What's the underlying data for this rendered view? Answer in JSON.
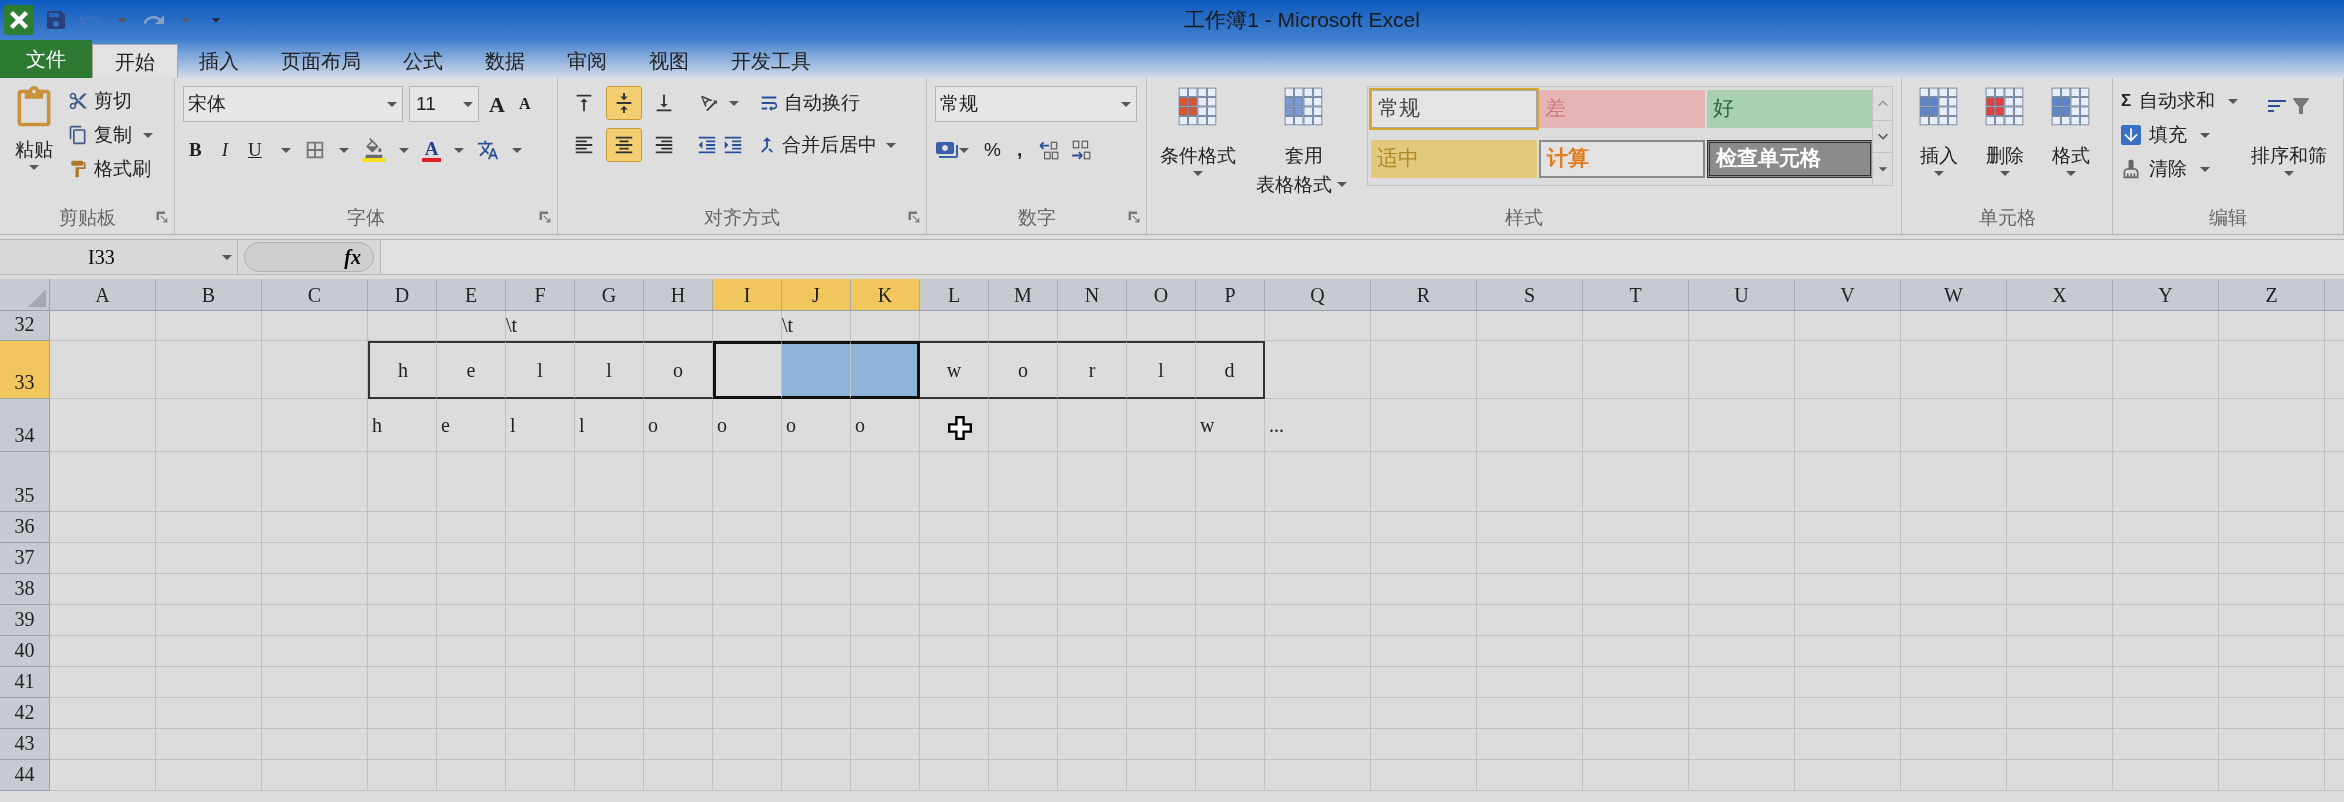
{
  "window": {
    "title": "工作簿1 - Microsoft Excel"
  },
  "tabs": [
    {
      "label": "文件",
      "kind": "file",
      "selected": false
    },
    {
      "label": "开始",
      "kind": "tab",
      "selected": true
    },
    {
      "label": "插入",
      "kind": "tab",
      "selected": false
    },
    {
      "label": "页面布局",
      "kind": "tab",
      "selected": false
    },
    {
      "label": "公式",
      "kind": "tab",
      "selected": false
    },
    {
      "label": "数据",
      "kind": "tab",
      "selected": false
    },
    {
      "label": "审阅",
      "kind": "tab",
      "selected": false
    },
    {
      "label": "视图",
      "kind": "tab",
      "selected": false
    },
    {
      "label": "开发工具",
      "kind": "tab",
      "selected": false
    }
  ],
  "ribbon": {
    "clipboard": {
      "label": "剪贴板",
      "paste": "粘贴",
      "cut": "剪切",
      "copy": "复制",
      "format_painter": "格式刷"
    },
    "font": {
      "label": "字体",
      "name": "宋体",
      "size": "11",
      "grow": "A",
      "shrink": "A",
      "bold": "B",
      "italic": "I",
      "underline": "U",
      "font_color": "A"
    },
    "alignment": {
      "label": "对齐方式",
      "vertical": [
        {
          "selected": false
        },
        {
          "selected": true
        },
        {
          "selected": false
        }
      ],
      "horizontal": [
        {
          "selected": false
        },
        {
          "selected": true
        },
        {
          "selected": false
        }
      ],
      "wrap": "自动换行",
      "merge": "合并后居中"
    },
    "number": {
      "label": "数字",
      "format": "常规",
      "percent": "%",
      "comma": ","
    },
    "styles": {
      "label": "样式",
      "conditional": "条件格式",
      "table_top": "套用",
      "table_bottom": "表格格式",
      "gallery": [
        {
          "label": "常规",
          "kind": "normal",
          "selected": true
        },
        {
          "label": "差",
          "kind": "bad",
          "selected": false
        },
        {
          "label": "好",
          "kind": "good",
          "selected": false
        },
        {
          "label": "适中",
          "kind": "neutral",
          "selected": false
        },
        {
          "label": "计算",
          "kind": "calculation",
          "selected": false
        },
        {
          "label": "检查单元格",
          "kind": "check",
          "selected": false
        }
      ]
    },
    "cells": {
      "label": "单元格",
      "items": [
        "插入",
        "删除",
        "格式"
      ]
    },
    "editing": {
      "label": "编辑",
      "sigma": "Σ",
      "autosum": "自动求和",
      "fill": "填充",
      "clear": "清除",
      "sort": "排序和筛"
    }
  },
  "formula_bar": {
    "name_box": "I33",
    "fx": "fx"
  },
  "columns": [
    {
      "label": "A",
      "selected": false
    },
    {
      "label": "B",
      "selected": false
    },
    {
      "label": "C",
      "selected": false
    },
    {
      "label": "D",
      "selected": false
    },
    {
      "label": "E",
      "selected": false
    },
    {
      "label": "F",
      "selected": false
    },
    {
      "label": "G",
      "selected": false
    },
    {
      "label": "H",
      "selected": false
    },
    {
      "label": "I",
      "selected": true
    },
    {
      "label": "J",
      "selected": true
    },
    {
      "label": "K",
      "selected": true
    },
    {
      "label": "L",
      "selected": false
    },
    {
      "label": "M",
      "selected": false
    },
    {
      "label": "N",
      "selected": false
    },
    {
      "label": "O",
      "selected": false
    },
    {
      "label": "P",
      "selected": false
    },
    {
      "label": "Q",
      "selected": false
    },
    {
      "label": "R",
      "selected": false
    },
    {
      "label": "S",
      "selected": false
    },
    {
      "label": "T",
      "selected": false
    },
    {
      "label": "U",
      "selected": false
    },
    {
      "label": "V",
      "selected": false
    },
    {
      "label": "W",
      "selected": false
    },
    {
      "label": "X",
      "selected": false
    },
    {
      "label": "Y",
      "selected": false
    },
    {
      "label": "Z",
      "selected": false
    }
  ],
  "rows": [
    {
      "label": "32",
      "kind": "label",
      "selected": false,
      "cells": [
        null,
        null,
        null,
        null,
        null,
        "\\t",
        null,
        null,
        null,
        "\\t"
      ]
    },
    {
      "label": "33",
      "kind": "boxed",
      "selected": true,
      "cells": [
        null,
        null,
        null,
        "h",
        "e",
        "l",
        "l",
        "o",
        null,
        null,
        null,
        "w",
        "o",
        "r",
        "l",
        "d"
      ]
    },
    {
      "label": "34",
      "kind": "plain",
      "selected": false,
      "cells": [
        null,
        null,
        null,
        "h",
        "e",
        "l",
        "l",
        "o",
        "o",
        "o",
        "o",
        null,
        null,
        null,
        null,
        "w",
        "..."
      ]
    },
    {
      "label": "35",
      "kind": "plain",
      "selected": false
    },
    {
      "label": "36",
      "kind": "plain",
      "selected": false
    },
    {
      "label": "37",
      "kind": "plain",
      "selected": false
    },
    {
      "label": "38",
      "kind": "plain",
      "selected": false
    },
    {
      "label": "39",
      "kind": "plain",
      "selected": false
    },
    {
      "label": "40",
      "kind": "plain",
      "selected": false
    },
    {
      "label": "41",
      "kind": "plain",
      "selected": false
    },
    {
      "label": "42",
      "kind": "plain",
      "selected": false
    },
    {
      "label": "43",
      "kind": "plain",
      "selected": false
    },
    {
      "label": "44",
      "kind": "plain",
      "selected": false
    }
  ]
}
